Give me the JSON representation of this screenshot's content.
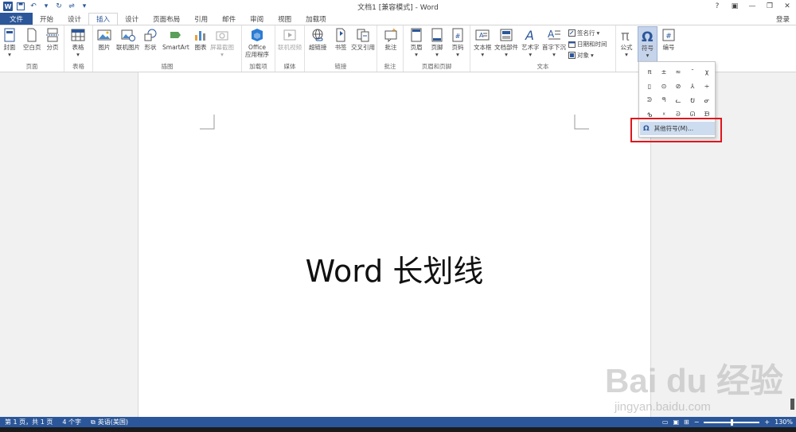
{
  "title_bar": {
    "title": "文档1 [兼容模式] - Word",
    "word_logo": "W",
    "qat_icons": [
      "save-icon",
      "undo-icon",
      "redo-icon",
      "customize-icon"
    ],
    "help": "?",
    "ribbon_toggle": "▣",
    "minimize": "—",
    "restore": "❐",
    "close": "✕"
  },
  "tabs": [
    {
      "label": "文件"
    },
    {
      "label": "开始"
    },
    {
      "label": "设计"
    },
    {
      "label": "插入"
    },
    {
      "label": "设计"
    },
    {
      "label": "页面布局"
    },
    {
      "label": "引用"
    },
    {
      "label": "邮件"
    },
    {
      "label": "审阅"
    },
    {
      "label": "视图"
    },
    {
      "label": "加载项"
    }
  ],
  "login": "登录",
  "ribbon": {
    "groups": {
      "pages": "页面",
      "tables": "表格",
      "illustrations": "插图",
      "addins": "加载项",
      "media": "媒体",
      "links": "链接",
      "comments": "批注",
      "header_footer": "页眉和页脚",
      "text": "文本"
    },
    "buttons": {
      "cover": "封面",
      "blank_page": "空白页",
      "page_break": "分页",
      "table": "表格",
      "picture": "图片",
      "online_picture": "联机图片",
      "shapes": "形状",
      "smartart": "SmartArt",
      "chart": "图表",
      "screenshot": "屏幕截图",
      "office_apps_1": "Office",
      "office_apps_2": "应用程序",
      "online_video": "联机视频",
      "hyperlink": "超链接",
      "bookmark": "书签",
      "cross_ref": "交叉引用",
      "comment": "批注",
      "header": "页眉",
      "footer": "页脚",
      "page_number": "页码",
      "text_box": "文本框",
      "quick_parts": "文档部件",
      "wordart": "艺术字",
      "drop_cap": "首字下沉",
      "signature": "签名行",
      "date_time": "日期和时间",
      "object": "对象",
      "equation": "公式",
      "symbol": "符号",
      "numbering": "编号"
    }
  },
  "document": {
    "text": "Word 长划线"
  },
  "symbols": [
    "π",
    "±",
    "≈",
    "¯",
    "χ",
    "▯",
    "⊙",
    "⊘",
    "⅄",
    "∻",
    "ᕲ",
    "ᖗ",
    "ᓚ",
    "ᕞ",
    "ᓂ",
    "ᕹ",
    "ᕽ",
    "ᘐ",
    "ᘏ",
    "ᙖ"
  ],
  "more_symbols": "其他符号(M)...",
  "status": {
    "page": "第 1 页，共 1 页",
    "words": "4 个字",
    "language": "英语(美国)",
    "zoom": "130%"
  },
  "watermark": {
    "brand": "Bai du 经验",
    "url": "jingyan.baidu.com"
  },
  "colors": {
    "accent": "#2b579a",
    "highlight": "#e0161d"
  }
}
